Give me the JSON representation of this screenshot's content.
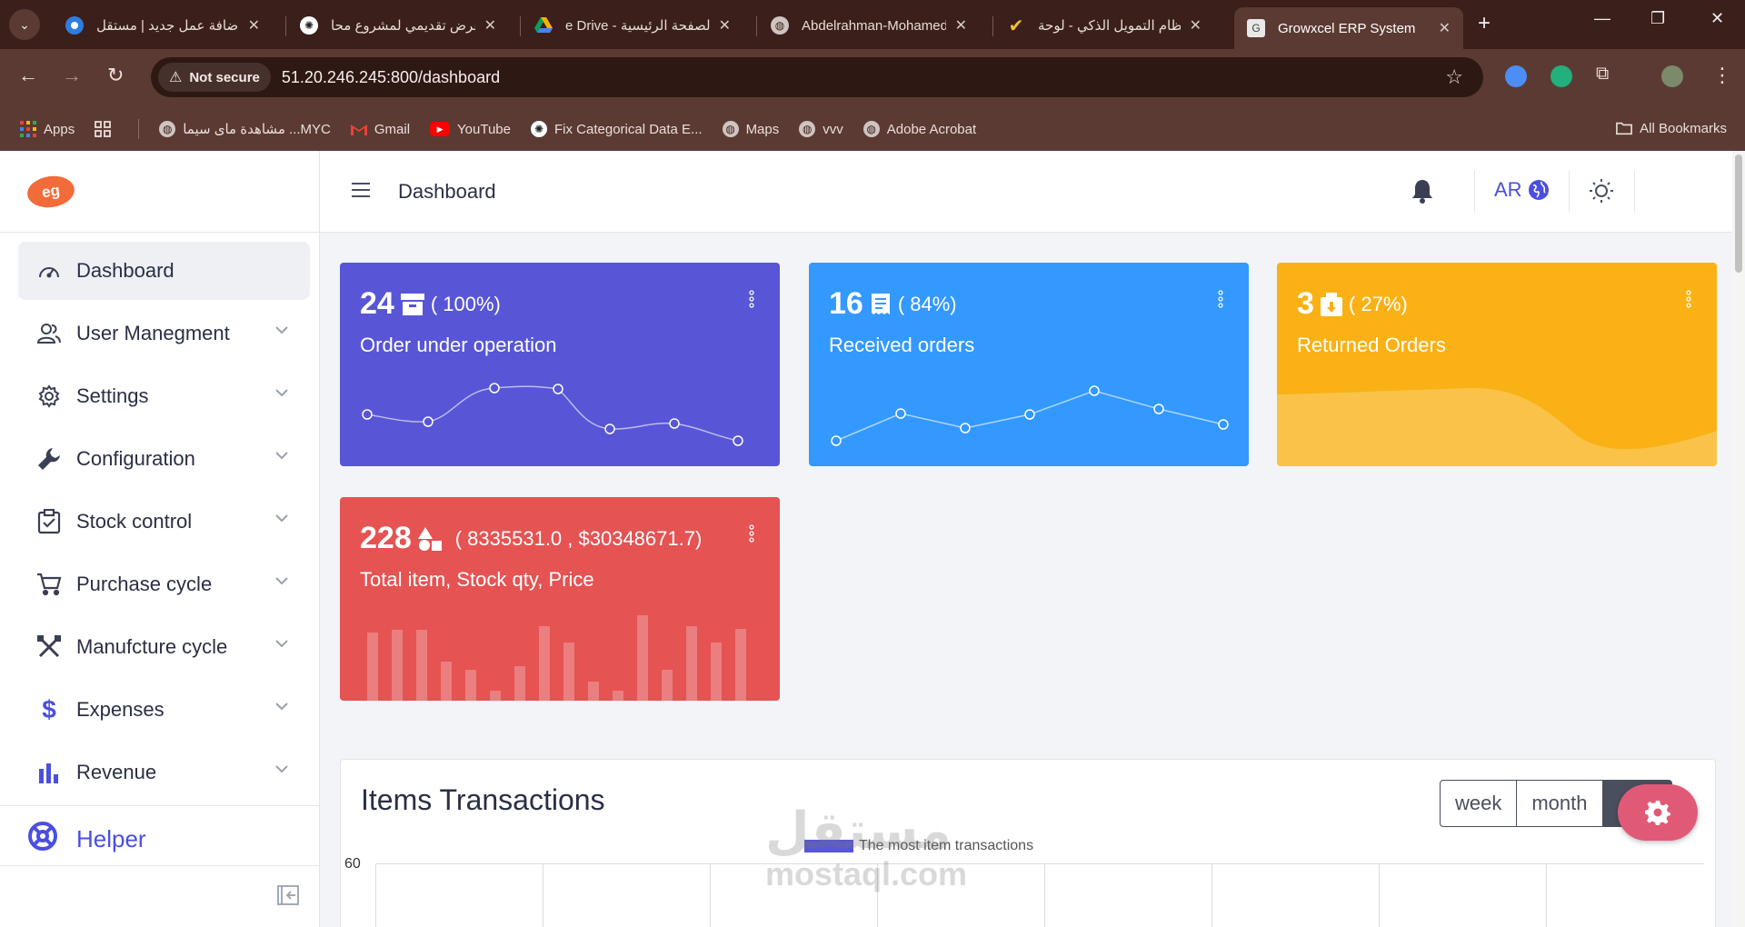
{
  "browser": {
    "tabs": [
      {
        "label": "إضافة عمل جديد | مستقل",
        "close": "✕"
      },
      {
        "label": "عرض تقديمي لمشروع محا",
        "close": "✕"
      },
      {
        "label": "e Drive - الصفحة الرئيسية",
        "close": "✕"
      },
      {
        "label": "Abdelrahman-Mohamed",
        "close": "✕"
      },
      {
        "label": "نظام التمويل الذكي - لوحة",
        "close": "✕"
      },
      {
        "label": "Growxcel ERP System",
        "close": "✕"
      }
    ],
    "security_label": "Not secure",
    "url": "51.20.246.245:800/dashboard",
    "bookmarks": [
      {
        "label": "Apps"
      },
      {
        "label": "مشاهدة ماى سيما ...MYC"
      },
      {
        "label": "Gmail"
      },
      {
        "label": "YouTube"
      },
      {
        "label": "Fix Categorical Data E..."
      },
      {
        "label": "Maps"
      },
      {
        "label": "vvv"
      },
      {
        "label": "Adobe Acrobat"
      }
    ],
    "all_bookmarks": "All Bookmarks"
  },
  "app": {
    "logo_text": "eg",
    "page_title": "Dashboard",
    "language": "AR",
    "sidebar": {
      "items": [
        {
          "label": "Dashboard"
        },
        {
          "label": "User Manegment"
        },
        {
          "label": "Settings"
        },
        {
          "label": "Configuration"
        },
        {
          "label": "Stock control"
        },
        {
          "label": "Purchase cycle"
        },
        {
          "label": "Manufcture cycle"
        },
        {
          "label": "Expenses"
        },
        {
          "label": "Revenue"
        }
      ],
      "helper": "Helper"
    },
    "cards": [
      {
        "value": "24",
        "pct": "( 100%)",
        "label": "Order under operation",
        "color": "#5856d6"
      },
      {
        "value": "16",
        "pct": "( 84%)",
        "label": "Received orders",
        "color": "#3399ff"
      },
      {
        "value": "3",
        "pct": "( 27%)",
        "label": "Returned Orders",
        "color": "#f9b115"
      },
      {
        "value": "228",
        "pct": "( 8335531.0 , $30348671.7)",
        "label": "Total item, Stock qty, Price",
        "color": "#e55353"
      }
    ],
    "transactions": {
      "title": "Items Transactions",
      "periods": [
        "week",
        "month",
        ""
      ],
      "legend": "The most item transactions",
      "y_tick": "60"
    }
  },
  "watermark": {
    "line1": "مستقل",
    "line2": "mostaql.com"
  },
  "icons": {
    "menu": [
      "speedometer-icon",
      "users-icon",
      "gear-icon",
      "wrench-icon",
      "clipboard-icon",
      "cart-icon",
      "tools-icon",
      "dollar-icon",
      "bar-chart-icon"
    ],
    "helper": "lifebuoy-icon",
    "bell": "bell-icon",
    "globe": "globe-icon",
    "sun": "sun-icon"
  },
  "colors": {
    "accent": "#4b4fe0",
    "card_purple": "#5856d6",
    "card_blue": "#3399ff",
    "card_yellow": "#f9b115",
    "card_red": "#e55353",
    "fab": "#e05a78"
  }
}
